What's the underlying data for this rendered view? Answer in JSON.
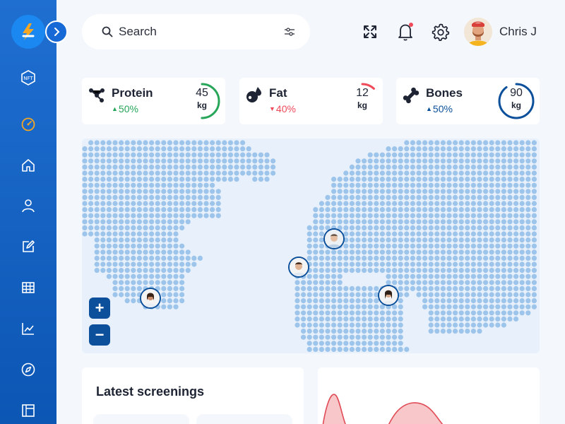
{
  "header": {
    "search_label": "Search",
    "user_name": "Chris J"
  },
  "stats": [
    {
      "title": "Protein",
      "trend": "50%",
      "trend_direction": "up",
      "trend_color": "#27a65a",
      "value": "45",
      "unit": "kg",
      "gauge_fraction": 0.5,
      "gauge_color": "#27a65a"
    },
    {
      "title": "Fat",
      "trend": "40%",
      "trend_direction": "down",
      "trend_color": "#ef4a5a",
      "value": "12",
      "unit": "kg",
      "gauge_fraction": 0.12,
      "gauge_color": "#ef4a5a"
    },
    {
      "title": "Bones",
      "trend": "50%",
      "trend_direction": "up",
      "trend_color": "#0c4f9a",
      "value": "90",
      "unit": "kg",
      "gauge_fraction": 0.9,
      "gauge_color": "#0c4f9a"
    }
  ],
  "map": {
    "zoom_in_label": "+",
    "zoom_out_label": "−"
  },
  "panels": {
    "latest_screenings_title": "Latest screenings"
  },
  "colors": {
    "sidebar": "#1769d6",
    "accent": "#0c4f9a",
    "active_nav": "#f5a623"
  },
  "sidebar_icons": [
    "nft-icon",
    "dashboard-gauge-icon",
    "home-icon",
    "user-icon",
    "edit-icon",
    "table-icon",
    "line-chart-icon",
    "compass-icon",
    "layout-icon"
  ]
}
